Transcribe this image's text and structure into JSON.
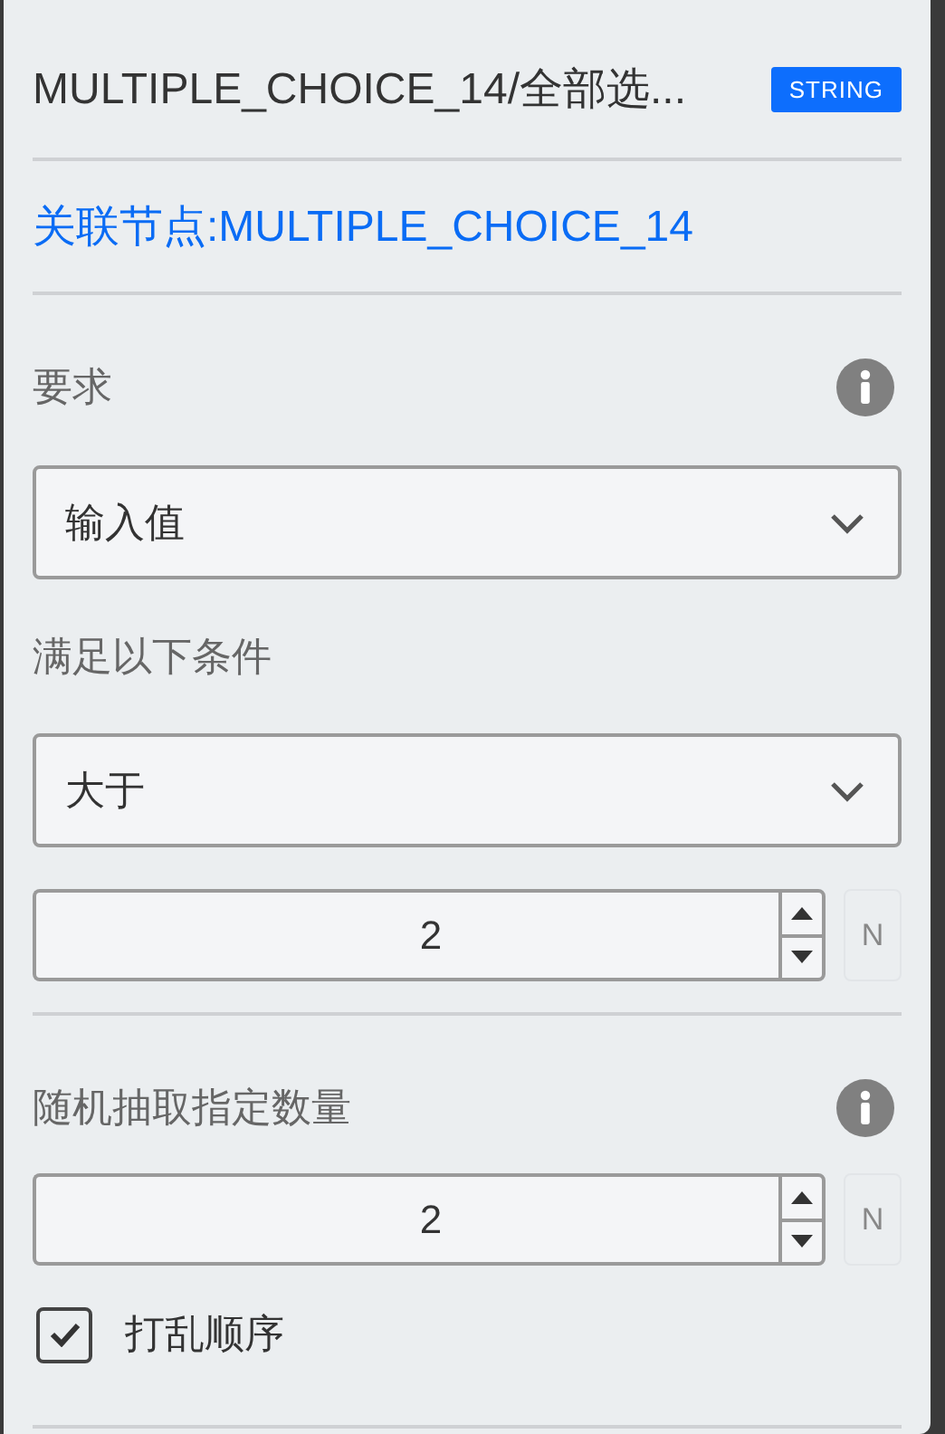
{
  "header": {
    "title": "MULTIPLE_CHOICE_14/全部选...",
    "type_badge": "STRING"
  },
  "linked_node": "关联节点:MULTIPLE_CHOICE_14",
  "requirement": {
    "label": "要求",
    "select": "输入值"
  },
  "condition": {
    "label": "满足以下条件",
    "select": "大于",
    "value": "2",
    "unit": "N"
  },
  "random_pick": {
    "label": "随机抽取指定数量",
    "value": "2",
    "unit": "N"
  },
  "shuffle": {
    "label": "打乱顺序",
    "checked": true
  }
}
